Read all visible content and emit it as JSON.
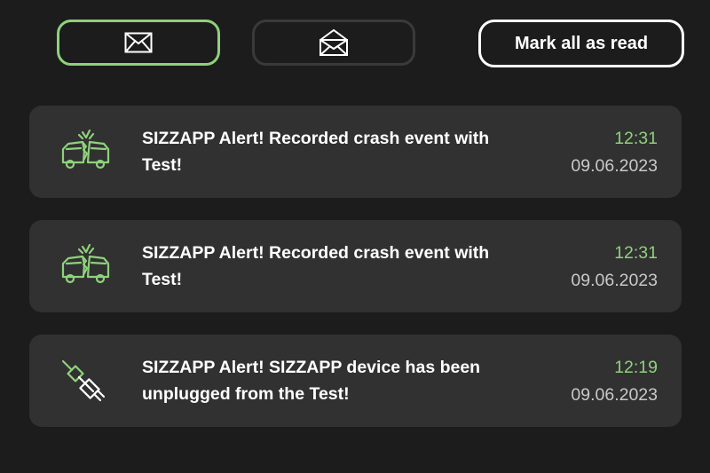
{
  "toolbar": {
    "unread_tab": {
      "icon": "closed-envelope-icon",
      "active": true
    },
    "read_tab": {
      "icon": "open-envelope-icon",
      "active": false
    },
    "mark_all_label": "Mark all as read"
  },
  "colors": {
    "background": "#1c1c1c",
    "card": "#313131",
    "accent": "#8fd17c",
    "text": "#ffffff",
    "muted": "#c9c9c9"
  },
  "notifications": [
    {
      "icon": "car-crash-icon",
      "message": "SIZZAPP Alert! Recorded crash event with Test!",
      "time": "12:31",
      "date": "09.06.2023"
    },
    {
      "icon": "car-crash-icon",
      "message": "SIZZAPP Alert! Recorded crash event with Test!",
      "time": "12:31",
      "date": "09.06.2023"
    },
    {
      "icon": "unplugged-device-icon",
      "message": "SIZZAPP Alert! SIZZAPP device has been unplugged from the Test!",
      "time": "12:19",
      "date": "09.06.2023"
    }
  ]
}
